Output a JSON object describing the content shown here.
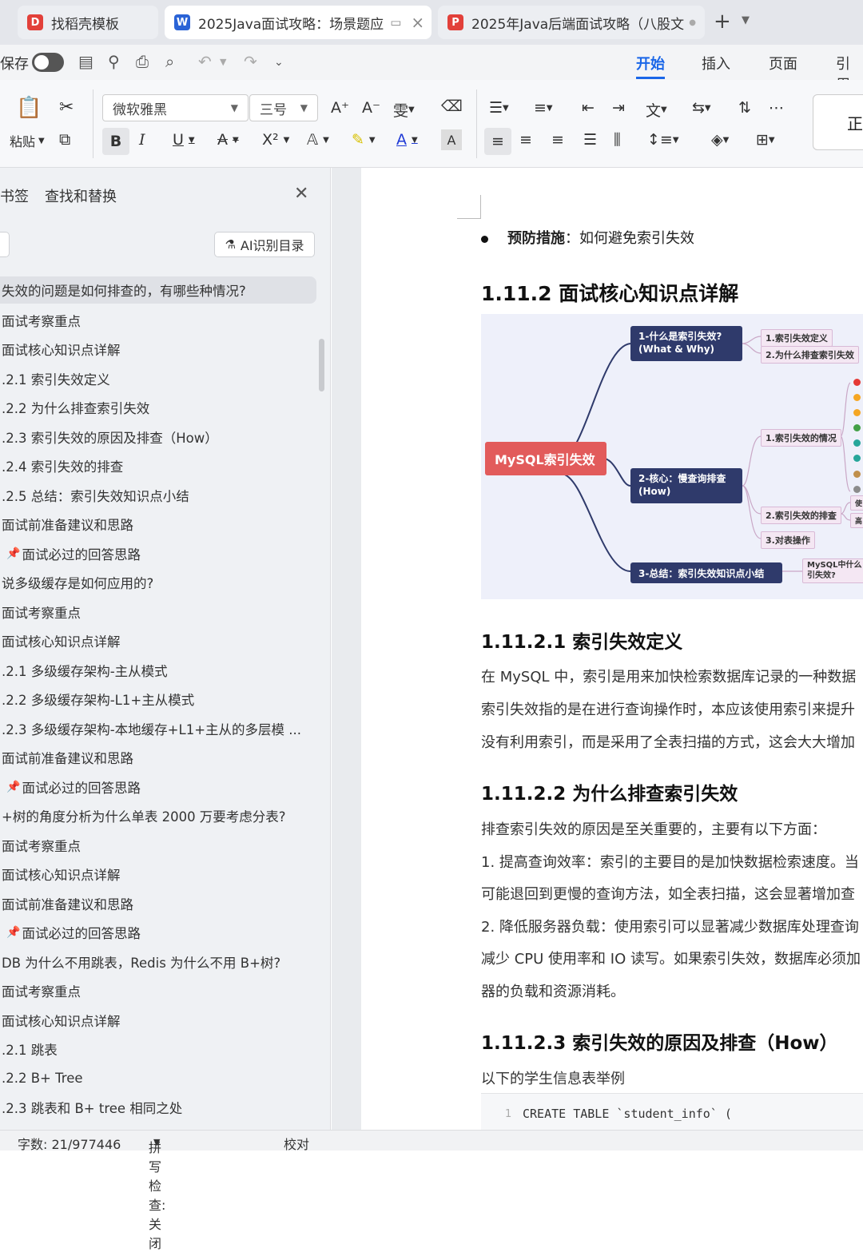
{
  "tabs": [
    {
      "label": "找稻壳模板",
      "icon": "docer-icon",
      "color": "#e2403a"
    },
    {
      "label": "2025Java面试攻略：场景题应",
      "icon": "word-icon",
      "color": "#2a63d6"
    },
    {
      "label": "2025年Java后端面试攻略（八股文",
      "icon": "pdf-icon",
      "color": "#e2403a"
    }
  ],
  "ribbon": {
    "save_label": "保存",
    "menus": [
      "开始",
      "插入",
      "页面",
      "引用"
    ]
  },
  "toolbar": {
    "paste_label": "粘贴",
    "font_family": "微软雅黑",
    "font_size": "三号"
  },
  "sidebar": {
    "tab_bookmark": "书签",
    "tab_find": "查找和替换",
    "ai_button": "AI识别目录",
    "toc": [
      "失效的问题是如何排查的，有哪些种情况?",
      "面试考察重点",
      "面试核心知识点详解",
      ".2.1 索引失效定义",
      ".2.2 为什么排查索引失效",
      ".2.3 索引失效的原因及排查（How）",
      ".2.4  索引失效的排查",
      ".2.5 总结：索引失效知识点小结",
      "面试前准备建议和思路",
      "面试必过的回答思路",
      "说多级缓存是如何应用的?",
      "面试考察重点",
      "面试核心知识点详解",
      ".2.1 多级缓存架构-主从模式",
      ".2.2 多级缓存架构-L1+主从模式",
      ".2.3 多级缓存架构-本地缓存+L1+主从的多层模 ...",
      "面试前准备建议和思路",
      "面试必过的回答思路",
      "+树的角度分析为什么单表 2000 万要考虑分表?",
      "面试考察重点",
      "面试核心知识点详解",
      "面试前准备建议和思路",
      "面试必过的回答思路",
      "DB 为什么不用跳表，Redis 为什么不用 B+树?",
      "面试考察重点",
      "面试核心知识点详解",
      ".2.1 跳表",
      ".2.2 B+ Tree",
      ".2.3 跳表和 B+ tree 相同之处"
    ]
  },
  "doc": {
    "bullet_bold": "预防措施",
    "bullet_text": "：如何避免索引失效",
    "h_core": "1.11.2  面试核心知识点详解",
    "mindmap": {
      "root": "MySQL索引失效",
      "n1": "1-什么是索引失效?\n(What & Why)",
      "n1_leaf1": "1.索引失效定义",
      "n1_leaf2": "2.为什么排查索引失效",
      "n2": "2-核心：慢查询排查\n(How)",
      "n2_leaf1": "1.索引失效的情况",
      "n2_leaf2": "2.索引失效的排查",
      "n2_leaf3": "3.对表操作",
      "n2_leaf4": "使",
      "n2_leaf5": "高",
      "n3": "3-总结：索引失效知识点小结",
      "n3_leaf1": "MySQL中什么\n引失效?"
    },
    "h_def": "1.11.2.1  索引失效定义",
    "def_p1": "在 MySQL 中，索引是用来加快检索数据库记录的一种数据",
    "def_p2": "索引失效指的是在进行查询操作时，本应该使用索引来提升",
    "def_p3": "没有利用索引，而是采用了全表扫描的方式，这会大大增加",
    "h_why": "1.11.2.2  为什么排查索引失效",
    "why_p1": "排查索引失效的原因是至关重要的，主要有以下方面：",
    "why_p2": "1. 提高查询效率：索引的主要目的是加快数据检索速度。当",
    "why_p3": "可能退回到更慢的查询方法，如全表扫描，这会显著增加查",
    "why_p4": "2. 降低服务器负载：使用索引可以显著减少数据库处理查询",
    "why_p5": "减少 CPU 使用率和 IO 读写。如果索引失效，数据库必须加",
    "why_p6": "器的负载和资源消耗。",
    "h_how": "1.11.2.3  索引失效的原因及排查（How）",
    "how_p1": "以下的学生信息表举例",
    "code_ln": "1",
    "code_line": "CREATE TABLE `student_info` ("
  },
  "status": {
    "wordcount": "字数: 21/977446",
    "spell": "拼写检查: 关闭",
    "proof": "校对"
  },
  "colors": {
    "accent": "#1a66e8",
    "mm_root": "#e25b5b",
    "mm_node": "#2f3a6b"
  }
}
